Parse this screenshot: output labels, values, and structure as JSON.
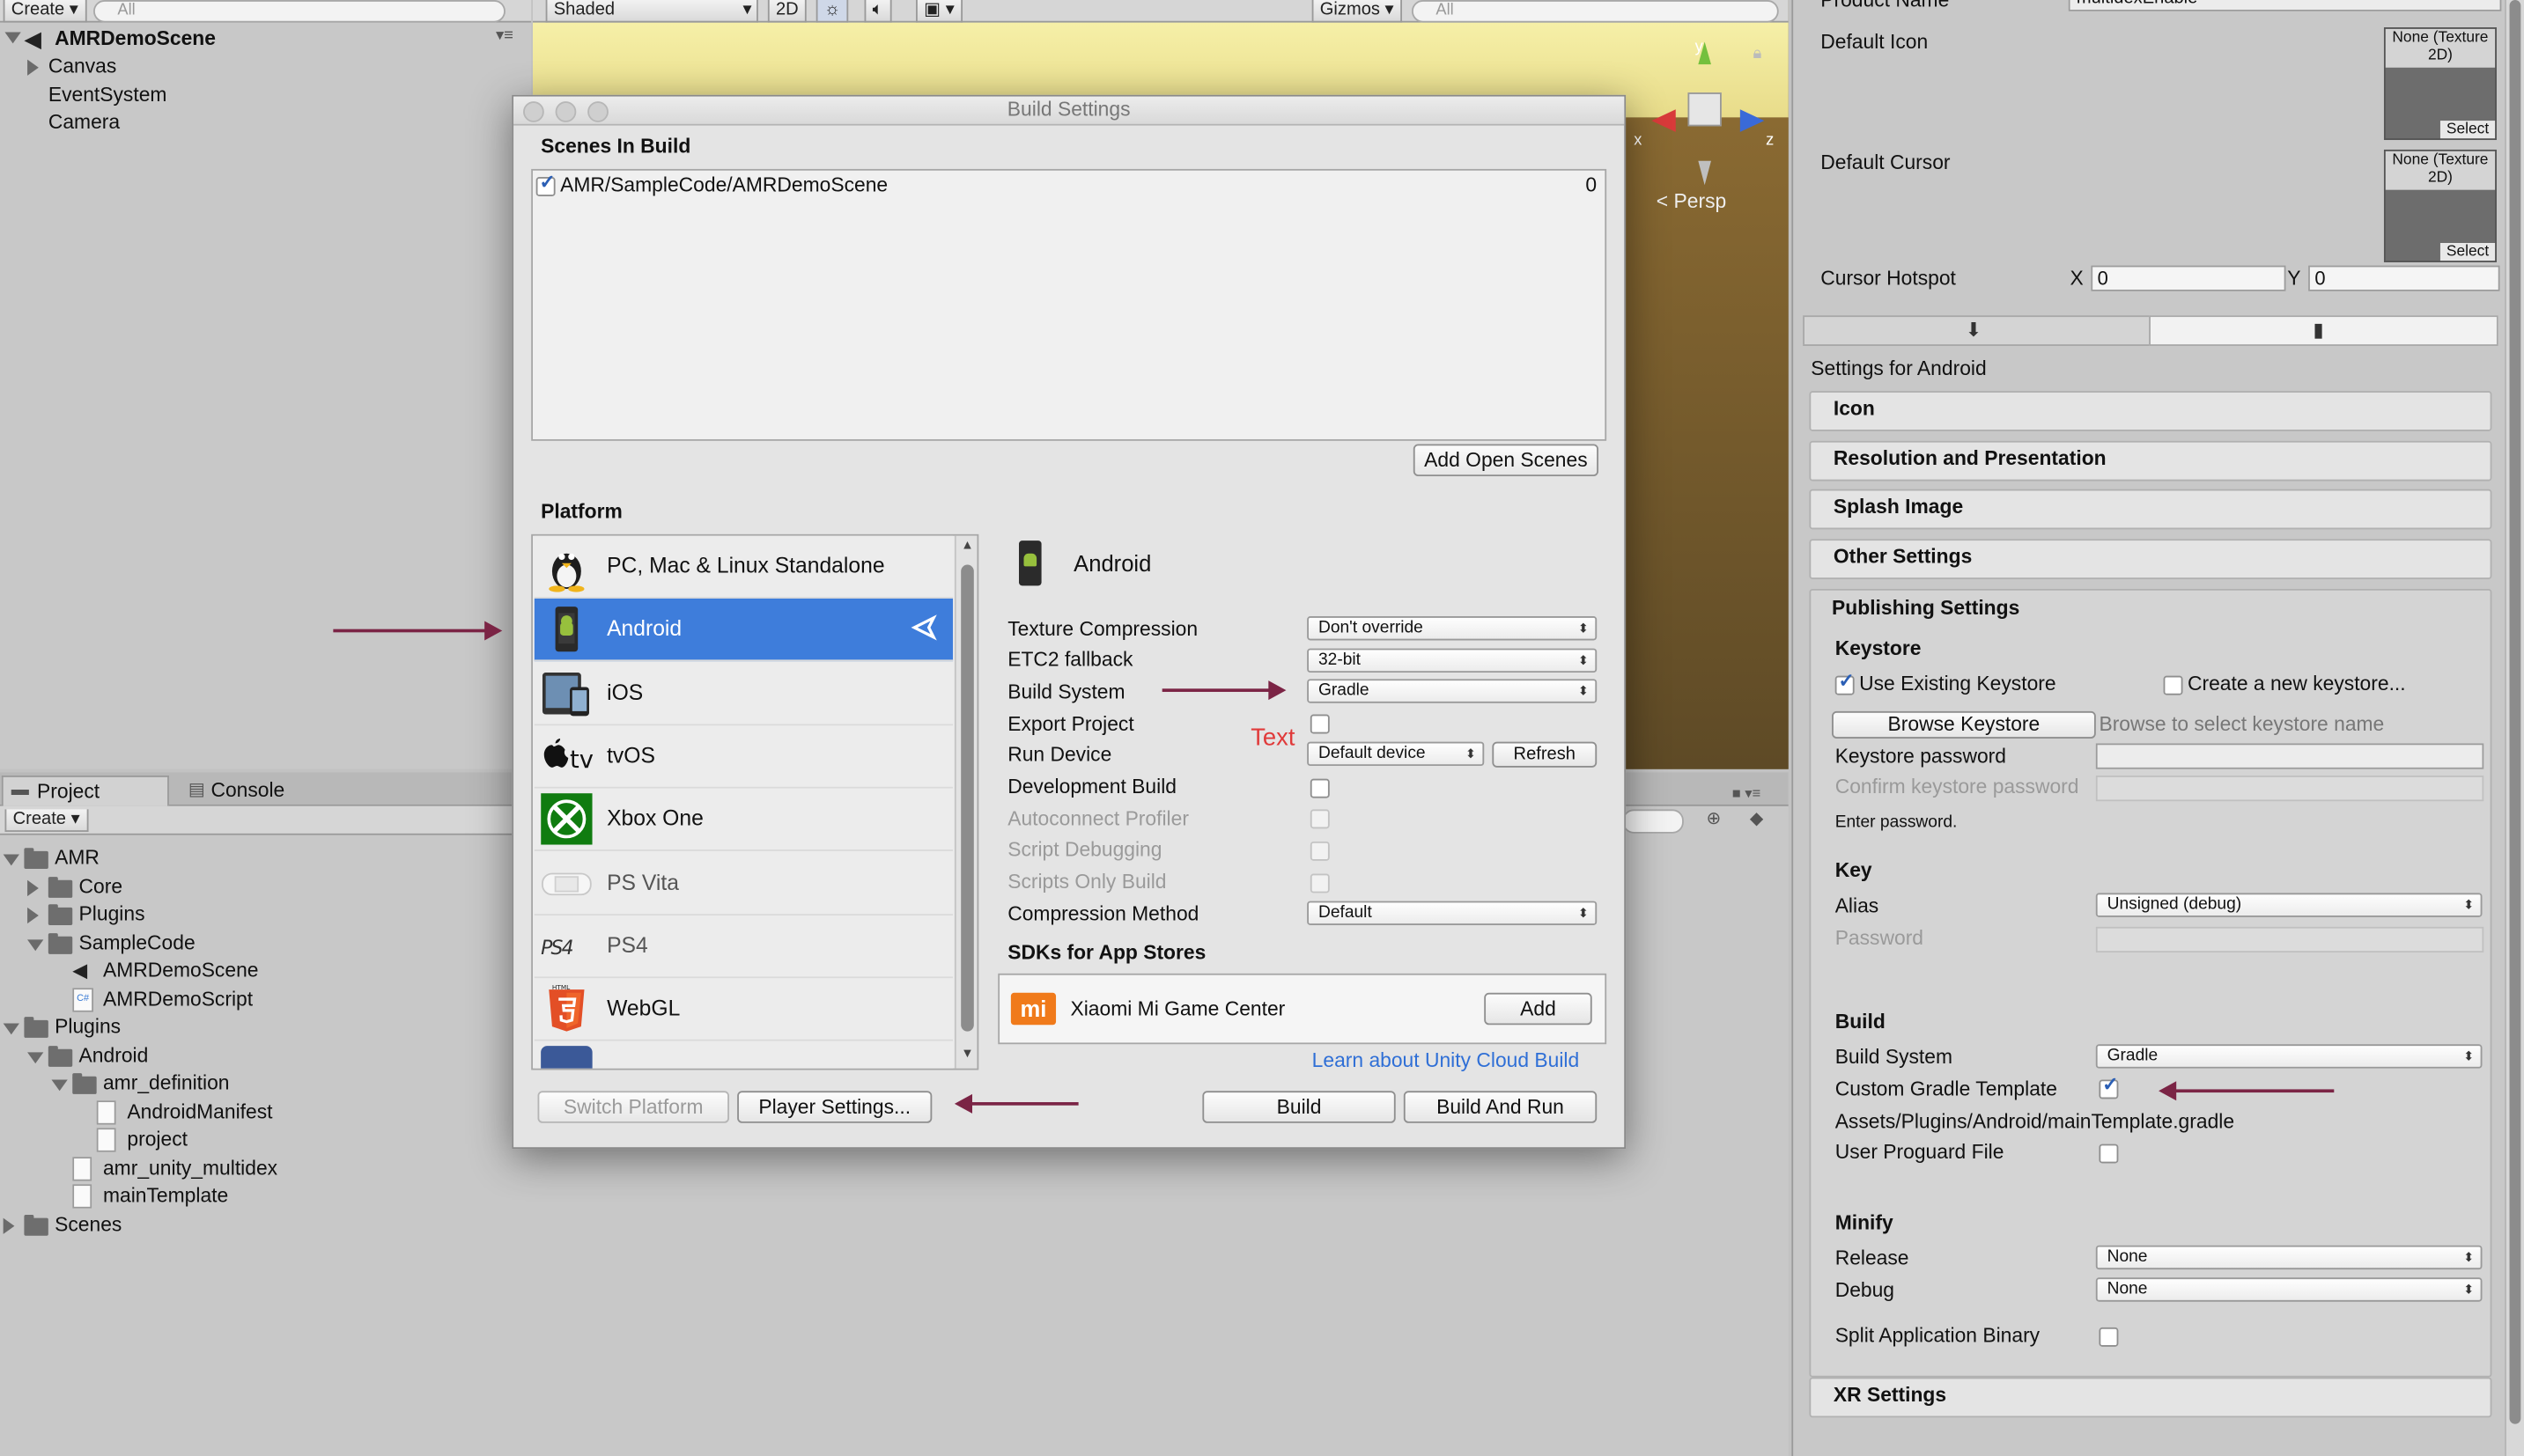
{
  "hierarchy": {
    "create": "Create",
    "search": "All",
    "scene": "AMRDemoScene",
    "items": [
      "Canvas",
      "EventSystem",
      "Camera"
    ]
  },
  "scene_view": {
    "shading": "Shaded",
    "mode2d": "2D",
    "gizmos": "Gizmos",
    "search": "All",
    "axis_y": "y",
    "axis_x": "x",
    "axis_z": "z",
    "persp": "Persp"
  },
  "project": {
    "tab_project": "Project",
    "tab_console": "Console",
    "create": "Create",
    "tree": [
      {
        "label": "AMR",
        "kind": "folder"
      },
      {
        "label": "Core",
        "kind": "folder"
      },
      {
        "label": "Plugins",
        "kind": "folder"
      },
      {
        "label": "SampleCode",
        "kind": "folder"
      },
      {
        "label": "AMRDemoScene",
        "kind": "scene"
      },
      {
        "label": "AMRDemoScript",
        "kind": "script"
      },
      {
        "label": "Plugins",
        "kind": "folder"
      },
      {
        "label": "Android",
        "kind": "folder"
      },
      {
        "label": "amr_definition",
        "kind": "folder"
      },
      {
        "label": "AndroidManifest",
        "kind": "file"
      },
      {
        "label": "project",
        "kind": "file"
      },
      {
        "label": "amr_unity_multidex",
        "kind": "file"
      },
      {
        "label": "mainTemplate",
        "kind": "file"
      },
      {
        "label": "Scenes",
        "kind": "folder"
      }
    ]
  },
  "build_settings": {
    "title": "Build Settings",
    "scenes_in_build": "Scenes In Build",
    "scene_path": "AMR/SampleCode/AMRDemoScene",
    "scene_index": "0",
    "add_open_scenes": "Add Open Scenes",
    "platform_label": "Platform",
    "platforms": [
      {
        "label": "PC, Mac & Linux Standalone",
        "icon": "linux-penguin-icon"
      },
      {
        "label": "Android",
        "icon": "android-phone-icon"
      },
      {
        "label": "iOS",
        "icon": "ios-devices-icon"
      },
      {
        "label": "tvOS",
        "icon": "apple-tv-icon"
      },
      {
        "label": "Xbox One",
        "icon": "xbox-icon"
      },
      {
        "label": "PS Vita",
        "icon": "ps-vita-icon"
      },
      {
        "label": "PS4",
        "icon": "ps4-icon"
      },
      {
        "label": "WebGL",
        "icon": "html5-icon"
      }
    ],
    "selected_platform": "Android",
    "settings": {
      "texture_compression": {
        "label": "Texture Compression",
        "value": "Don't override"
      },
      "etc2_fallback": {
        "label": "ETC2 fallback",
        "value": "32-bit"
      },
      "build_system": {
        "label": "Build System",
        "value": "Gradle"
      },
      "export_project": "Export Project",
      "run_device": {
        "label": "Run Device",
        "value": "Default device",
        "refresh": "Refresh"
      },
      "development_build": "Development Build",
      "autoconnect_profiler": "Autoconnect Profiler",
      "script_debugging": "Script Debugging",
      "scripts_only_build": "Scripts Only Build",
      "compression_method": {
        "label": "Compression Method",
        "value": "Default"
      }
    },
    "annotation_text": "Text",
    "sdks_label": "SDKs for App Stores",
    "sdk_name": "Xiaomi Mi Game Center",
    "sdk_add": "Add",
    "cloud_link": "Learn about Unity Cloud Build",
    "switch_platform": "Switch Platform",
    "player_settings": "Player Settings...",
    "build": "Build",
    "build_and_run": "Build And Run"
  },
  "inspector": {
    "product_name_label": "Product Name",
    "product_name_value": "multidexEnable",
    "default_icon": "Default Icon",
    "default_cursor": "Default Cursor",
    "texture_none": "None (Texture 2D)",
    "select": "Select",
    "cursor_hotspot": "Cursor Hotspot",
    "x_label": "X",
    "x_value": "0",
    "y_label": "Y",
    "y_value": "0",
    "settings_for": "Settings for Android",
    "sections": {
      "icon": "Icon",
      "resolution": "Resolution and Presentation",
      "splash": "Splash Image",
      "other": "Other Settings",
      "publishing": "Publishing Settings",
      "xr": "XR Settings"
    },
    "keystore": {
      "title": "Keystore",
      "use_existing": "Use Existing Keystore",
      "create_new": "Create a new keystore...",
      "browse": "Browse Keystore",
      "browse_hint": "Browse to select keystore name",
      "password": "Keystore password",
      "confirm": "Confirm keystore password",
      "enter_password": "Enter password."
    },
    "key": {
      "title": "Key",
      "alias": "Alias",
      "alias_value": "Unsigned (debug)",
      "password": "Password"
    },
    "build": {
      "title": "Build",
      "build_system": "Build System",
      "build_system_value": "Gradle",
      "custom_gradle": "Custom Gradle Template",
      "gradle_path": "Assets/Plugins/Android/mainTemplate.gradle",
      "user_proguard": "User Proguard File"
    },
    "minify": {
      "title": "Minify",
      "release": "Release",
      "release_value": "None",
      "debug": "Debug",
      "debug_value": "None",
      "split_binary": "Split Application Binary"
    }
  },
  "colors": {
    "selection": "#3e7ddb",
    "annotation_arrow": "#7b2445",
    "annotation_text": "#e03a3a",
    "link": "#2f6fd6"
  }
}
